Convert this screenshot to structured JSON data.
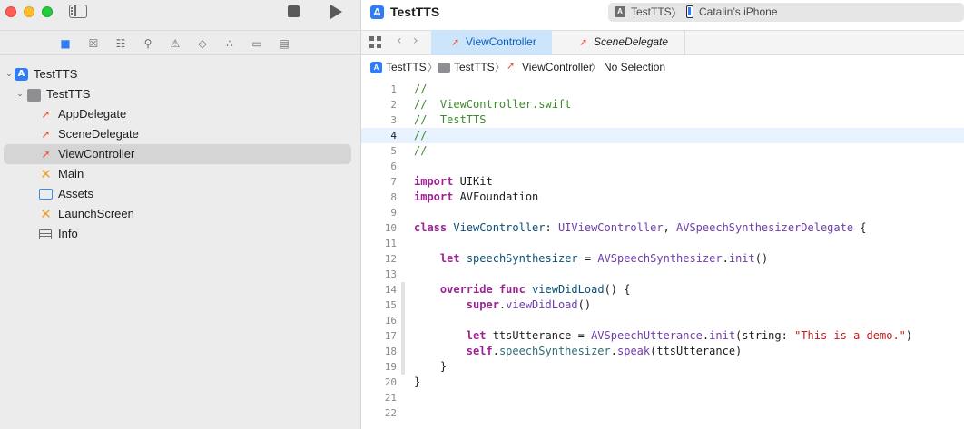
{
  "window": {
    "project_title": "TestTTS"
  },
  "scheme": {
    "name": "TestTTS",
    "separator": "〉",
    "device": "Catalin’s iPhone"
  },
  "navigator": {
    "tree": [
      {
        "label": "TestTTS",
        "icon": "app-project-icon",
        "level": 0,
        "expanded": true
      },
      {
        "label": "TestTTS",
        "icon": "folder-icon",
        "level": 1,
        "expanded": true
      },
      {
        "label": "AppDelegate",
        "icon": "swift-file-icon",
        "level": 2
      },
      {
        "label": "SceneDelegate",
        "icon": "swift-file-icon",
        "level": 2
      },
      {
        "label": "ViewController",
        "icon": "swift-file-icon",
        "level": 2,
        "selected": true
      },
      {
        "label": "Main",
        "icon": "storyboard-icon",
        "level": 2
      },
      {
        "label": "Assets",
        "icon": "asset-catalog-icon",
        "level": 2
      },
      {
        "label": "LaunchScreen",
        "icon": "storyboard-icon",
        "level": 2
      },
      {
        "label": "Info",
        "icon": "plist-table-icon",
        "level": 2
      }
    ]
  },
  "tabs": [
    {
      "label": "ViewController",
      "active": true
    },
    {
      "label": "SceneDelegate",
      "active": false
    }
  ],
  "jump_bar": {
    "items": [
      "TestTTS",
      "TestTTS",
      "ViewController",
      "No Selection"
    ]
  },
  "code": {
    "current_line": 4,
    "lines": [
      [
        {
          "t": "//",
          "c": "comment"
        }
      ],
      [
        {
          "t": "//  ViewController.swift",
          "c": "comment"
        }
      ],
      [
        {
          "t": "//  TestTTS",
          "c": "comment"
        }
      ],
      [
        {
          "t": "//",
          "c": "comment"
        }
      ],
      [
        {
          "t": "//",
          "c": "comment"
        }
      ],
      [],
      [
        {
          "t": "import",
          "c": "keyword"
        },
        {
          "t": " UIKit",
          "c": "plain"
        }
      ],
      [
        {
          "t": "import",
          "c": "keyword"
        },
        {
          "t": " AVFoundation",
          "c": "plain"
        }
      ],
      [],
      [
        {
          "t": "class",
          "c": "keyword"
        },
        {
          "t": " ViewController",
          "c": "classname"
        },
        {
          "t": ": ",
          "c": "plain"
        },
        {
          "t": "UIViewController",
          "c": "type"
        },
        {
          "t": ", ",
          "c": "plain"
        },
        {
          "t": "AVSpeechSynthesizerDelegate",
          "c": "type"
        },
        {
          "t": " {",
          "c": "plain"
        }
      ],
      [],
      [
        {
          "t": "    ",
          "c": "plain"
        },
        {
          "t": "let",
          "c": "keyword"
        },
        {
          "t": " ",
          "c": "plain"
        },
        {
          "t": "speechSynthesizer",
          "c": "classname"
        },
        {
          "t": " = ",
          "c": "plain"
        },
        {
          "t": "AVSpeechSynthesizer",
          "c": "type"
        },
        {
          "t": ".",
          "c": "plain"
        },
        {
          "t": "init",
          "c": "type"
        },
        {
          "t": "()",
          "c": "plain"
        }
      ],
      [],
      [
        {
          "t": "    ",
          "c": "plain"
        },
        {
          "t": "override",
          "c": "keyword"
        },
        {
          "t": " ",
          "c": "plain"
        },
        {
          "t": "func",
          "c": "keyword"
        },
        {
          "t": " ",
          "c": "plain"
        },
        {
          "t": "viewDidLoad",
          "c": "classname"
        },
        {
          "t": "() {",
          "c": "plain"
        }
      ],
      [
        {
          "t": "        ",
          "c": "plain"
        },
        {
          "t": "super",
          "c": "keyword"
        },
        {
          "t": ".",
          "c": "plain"
        },
        {
          "t": "viewDidLoad",
          "c": "type"
        },
        {
          "t": "()",
          "c": "plain"
        }
      ],
      [],
      [
        {
          "t": "        ",
          "c": "plain"
        },
        {
          "t": "let",
          "c": "keyword"
        },
        {
          "t": " ttsUtterance = ",
          "c": "plain"
        },
        {
          "t": "AVSpeechUtterance",
          "c": "type"
        },
        {
          "t": ".",
          "c": "plain"
        },
        {
          "t": "init",
          "c": "type"
        },
        {
          "t": "(string: ",
          "c": "plain"
        },
        {
          "t": "\"This is a demo.\"",
          "c": "string"
        },
        {
          "t": ")",
          "c": "plain"
        }
      ],
      [
        {
          "t": "        ",
          "c": "plain"
        },
        {
          "t": "self",
          "c": "keyword"
        },
        {
          "t": ".",
          "c": "plain"
        },
        {
          "t": "speechSynthesizer",
          "c": "func"
        },
        {
          "t": ".",
          "c": "plain"
        },
        {
          "t": "speak",
          "c": "type"
        },
        {
          "t": "(ttsUtterance)",
          "c": "plain"
        }
      ],
      [
        {
          "t": "    }",
          "c": "plain"
        }
      ],
      [
        {
          "t": "}",
          "c": "plain"
        }
      ],
      [],
      []
    ]
  },
  "colors": {
    "accent": "#2f7cf6",
    "swift": "#f05138",
    "current_line_bg": "#e8f2fe",
    "active_tab_bg": "#cde5fb"
  }
}
